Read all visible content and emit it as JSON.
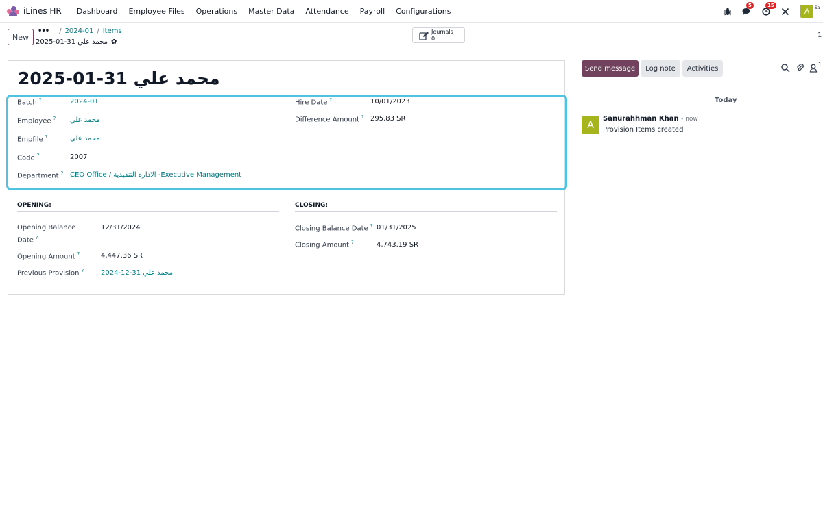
{
  "navbar": {
    "app_name": "iLines HR",
    "menu": [
      "Dashboard",
      "Employee Files",
      "Operations",
      "Master Data",
      "Attendance",
      "Payroll",
      "Configurations"
    ],
    "messages_badge": "5",
    "activities_badge": "15",
    "user_initial": "A",
    "user_db_text": "Sa"
  },
  "control": {
    "new_label": "New",
    "breadcrumb": [
      "2024-01",
      "Items"
    ],
    "breadcrumb_sep": "/",
    "record_name": "2025-01-31 محمد علي",
    "journals_label": "Journals",
    "journals_count": "0",
    "pager": "1"
  },
  "form": {
    "title": "2025-01-31 محمد علي",
    "help_mark": "?",
    "batch_label": "Batch",
    "batch_value": "2024-01",
    "employee_label": "Employee",
    "employee_value": "محمد علي",
    "empfile_label": "Empfile",
    "empfile_value": "محمد علي",
    "code_label": "Code",
    "code_value": "2007",
    "department_label": "Department",
    "department_value": "CEO Office / الادارة التنفيذية -Executive Management",
    "hire_date_label": "Hire Date",
    "hire_date_value": "10/01/2023",
    "difference_label": "Difference Amount",
    "difference_value": "295.83 SR",
    "opening_title": "OPENING:",
    "opening_balance_date_label_1": "Opening Balance",
    "opening_balance_date_label_2": "Date",
    "opening_balance_date_value": "12/31/2024",
    "opening_amount_label": "Opening Amount",
    "opening_amount_value": "4,447.36 SR",
    "previous_provision_label": "Previous Provision",
    "previous_provision_value": "2024-12-31 محمد علي",
    "closing_title": "CLOSING:",
    "closing_balance_date_label": "Closing Balance Date",
    "closing_balance_date_value": "01/31/2025",
    "closing_amount_label": "Closing Amount",
    "closing_amount_value": "4,743.19 SR"
  },
  "chatter": {
    "send_message_label": "Send message",
    "log_note_label": "Log note",
    "activities_label": "Activities",
    "followers_count": "1",
    "today_label": "Today",
    "message_avatar": "A",
    "message_author": "Sanurahhman Khan",
    "message_time": "- now",
    "message_body": "Provision Items created"
  },
  "colors": {
    "primary": "#71415e",
    "link": "#017e84",
    "highlight_border": "#4fc3df",
    "avatar": "#a6b41d",
    "badge": "#dc2626"
  },
  "icons": [
    "bug-icon",
    "chat-icon",
    "clock-icon",
    "tools-icon",
    "gear-icon",
    "edit-icon",
    "search-icon",
    "paperclip-icon",
    "user-icon"
  ]
}
